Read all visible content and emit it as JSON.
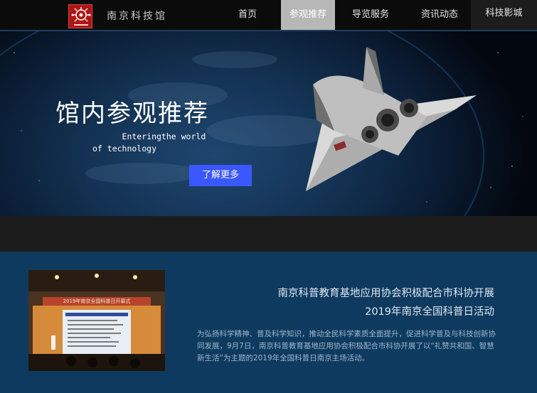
{
  "header": {
    "site_name": "南京科技馆",
    "nav": [
      {
        "label": "首页"
      },
      {
        "label": "参观推荐"
      },
      {
        "label": "导览服务"
      },
      {
        "label": "资讯动态"
      },
      {
        "label": "科技影城"
      }
    ]
  },
  "hero": {
    "title": "馆内参观推荐",
    "subtitle": "      Enteringthe world\nof technology",
    "button": "了解更多"
  },
  "news": {
    "title_line1": "南京科普教育基地应用协会积极配合市科协开展",
    "title_line2": "2019年南京全国科普日活动",
    "body": "为弘扬科学精神、普及科学知识，推动全民科学素质全面提升，促进科学普及与科技创新协同发展，9月7日，南京科普教育基地应用协会积极配合市科协开展了以“礼赞共和国、智慧新生活”为主题的2019年全国科普日南京主场活动。",
    "photo_banner": "2019年南京全国科普日开幕式"
  },
  "colors": {
    "nav_active": "#b7b7b7",
    "button": "#3b57ff",
    "news_bg": "#0e3a5f"
  }
}
